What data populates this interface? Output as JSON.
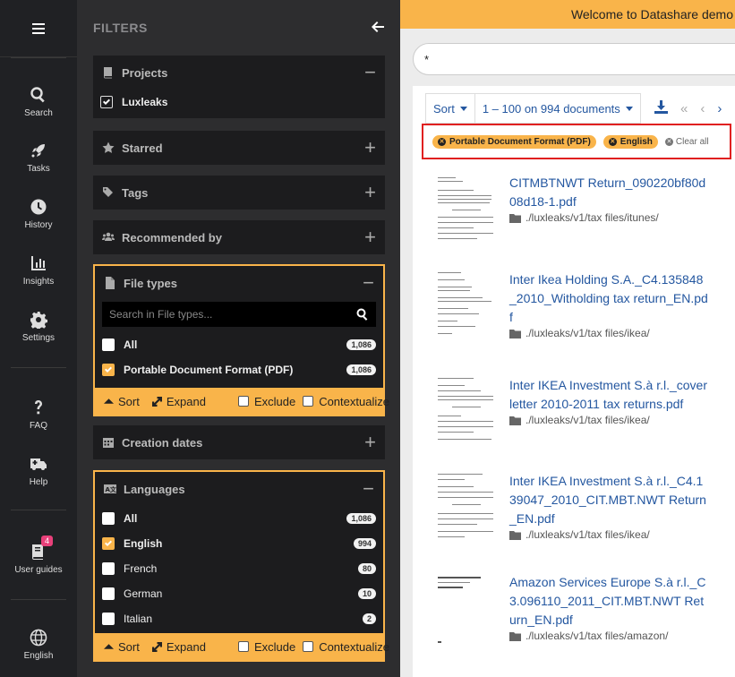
{
  "nav": {
    "items": [
      {
        "label": "Search",
        "icon": "search-icon"
      },
      {
        "label": "Tasks",
        "icon": "rocket-icon"
      },
      {
        "label": "History",
        "icon": "clock-icon"
      },
      {
        "label": "Insights",
        "icon": "chart-icon"
      },
      {
        "label": "Settings",
        "icon": "gear-icon"
      },
      {
        "label": "FAQ",
        "icon": "question-icon"
      },
      {
        "label": "Help",
        "icon": "ambulance-icon"
      },
      {
        "label": "User guides",
        "icon": "book-icon",
        "badge": "4"
      },
      {
        "label": "English",
        "icon": "globe-icon"
      }
    ]
  },
  "filters": {
    "title": "FILTERS",
    "projects": {
      "title": "Projects",
      "item": "Luxleaks"
    },
    "starred": {
      "title": "Starred"
    },
    "tags": {
      "title": "Tags"
    },
    "recommended": {
      "title": "Recommended by"
    },
    "filetypes": {
      "title": "File types",
      "search_placeholder": "Search in File types...",
      "items": [
        {
          "label": "All",
          "count": "1,086"
        },
        {
          "label": "Portable Document Format (PDF)",
          "count": "1,086"
        }
      ]
    },
    "creation": {
      "title": "Creation dates"
    },
    "languages": {
      "title": "Languages",
      "items": [
        {
          "label": "All",
          "count": "1,086"
        },
        {
          "label": "English",
          "count": "994"
        },
        {
          "label": "French",
          "count": "80"
        },
        {
          "label": "German",
          "count": "10"
        },
        {
          "label": "Italian",
          "count": "2"
        }
      ]
    },
    "footer": {
      "sort": "Sort",
      "expand": "Expand",
      "exclude": "Exclude",
      "contextualize": "Contextualize"
    }
  },
  "main": {
    "banner": "Welcome to Datashare demo",
    "query": "*",
    "sort_label": "Sort",
    "range_label": "1 – 100 on 994 documents",
    "chips": [
      "Portable Document Format (PDF)",
      "English"
    ],
    "clear_all": "Clear all",
    "docs": [
      {
        "title": "CITMBTNWT Return_090220bf80d08d18-1.pdf",
        "path": "./luxleaks/v1/tax files/itunes/"
      },
      {
        "title": "Inter Ikea Holding S.A._C4.135848_2010_Witholding tax return_EN.pdf",
        "path": "./luxleaks/v1/tax files/ikea/"
      },
      {
        "title": "Inter IKEA Investment S.à r.l._cover letter 2010-2011 tax returns.pdf",
        "path": "./luxleaks/v1/tax files/ikea/"
      },
      {
        "title": "Inter IKEA Investment S.à r.l._C4.139047_2010_CIT.MBT.NWT Return_EN.pdf",
        "path": "./luxleaks/v1/tax files/ikea/"
      },
      {
        "title": "Amazon Services Europe S.à r.l._C3.096110_2011_CIT.MBT.NWT Return_EN.pdf",
        "path": "./luxleaks/v1/tax files/amazon/"
      }
    ]
  },
  "colors": {
    "accent": "#f9b44a",
    "link": "#2457a0",
    "highlight_border": "#e02020"
  }
}
